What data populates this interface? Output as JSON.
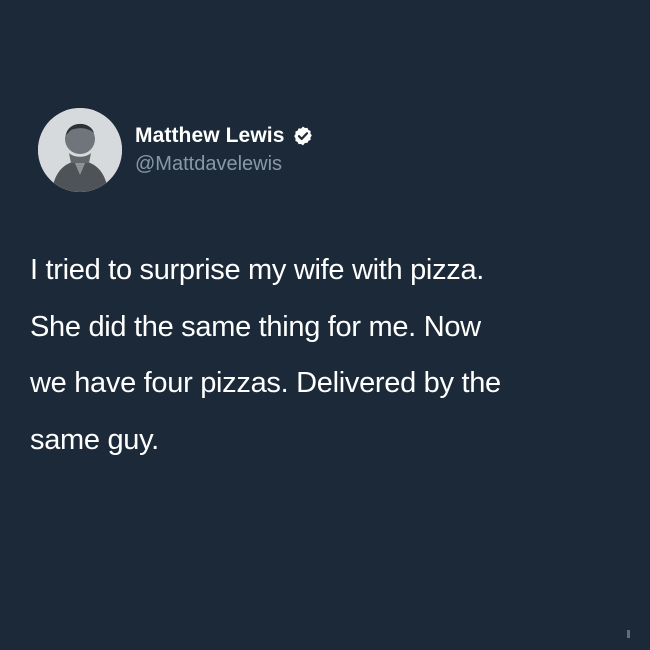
{
  "tweet": {
    "author": {
      "name": "Matthew Lewis",
      "handle": "@Mattdavelewis",
      "verified": true,
      "avatar_icon": "profile-photo"
    },
    "text_lines": [
      "I tried to surprise my wife with pizza.",
      "She did the same thing for me. Now",
      "we have four pizzas. Delivered by the",
      "same guy."
    ]
  },
  "theme": {
    "background": "#1c2938",
    "text": "#ffffff",
    "secondary_text": "#8899a6",
    "verified_badge": "#ffffff"
  }
}
